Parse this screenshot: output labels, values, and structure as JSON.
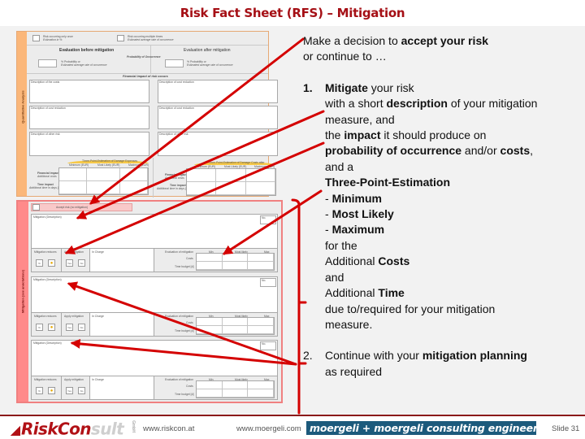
{
  "title": "Risk Fact Sheet (RFS) – Mitigation",
  "form": {
    "quant_section_label": "Quantitative Analysis",
    "mitigation_section_label": "Mitigation (see annotations)",
    "risk_once_label": "Risk occurring only once",
    "risk_once_sub": "Estimation in %",
    "risk_multi_label": "Risk occurring multiple times",
    "risk_multi_sub": "Estimated average rate of occurrence",
    "eval_before": "Evaluation before mitigation",
    "eval_after": "Evaluation after mitigation",
    "prob_occ": "Probability of Occurrence",
    "prob_label": "% Probability or",
    "prob_sub": "Estimated average rate of occurrence",
    "fin_impact_header": "Financial impact of risk occurs",
    "desc_costs": "Description of the costs",
    "desc_cost_reduction": "Description of cost reduction",
    "desc_other": "Description of other risk",
    "three_point_cost": "Three-Point-Estimation of Damage Expenses",
    "three_point_after": "Three-Point-Estimation of Damage Costs after",
    "col_min": "Minimum (EUR)",
    "col_ml": "Most Likely (EUR)",
    "col_max": "Maximum (EUR)",
    "fin_impact": "Financial impact",
    "fin_impact_sub": "Additional costs",
    "time_impact": "Time impact",
    "time_impact_sub": "Additional time in days [d]",
    "accept_label": "Accept risk (no mitigation)",
    "mit_desc_label": "Mitigation (Description)",
    "mit_no": "No.",
    "mit_reduces": "Mitigation reduces",
    "apply_mit": "Apply mitigation",
    "in_charge": "In Charge",
    "eval_mit": "Evaluation of mitigation",
    "costs": "Costs",
    "time_budget": "Time budget [d]",
    "min": "Min",
    "most_likely": "Most likely",
    "max": "Max",
    "pct": "%",
    "yes": "Yes",
    "no": "No",
    "coin_icon": "coins-icon"
  },
  "text": {
    "intro_1": "Make a decision to ",
    "intro_1_b": "accept your risk",
    "intro_2": "or continue to …",
    "item1_num": "1.",
    "item1_b": "Mitigate",
    "item1_rest": " your risk",
    "l2a": "with a short ",
    "l2b": "description",
    "l2c": " of your mitigation",
    "l3": "measure, and",
    "l4a": "the ",
    "l4b": "impact",
    "l4c": " it should produce on",
    "l5a": "probability of occurrence",
    "l5b": " and/or ",
    "l5c": "costs",
    "l5d": ",",
    "l6": "and a",
    "l7": "Three-Point-Estimation",
    "l8a": "- ",
    "l8b": "Minimum",
    "l9b": "Most Likely",
    "l10b": "Maximum",
    "l11": "for the",
    "l12a": "Additional ",
    "l12b": "Costs",
    "l13": "and",
    "l14a": "Additional ",
    "l14b": "Time",
    "l15": "due to/required for your mitigation",
    "l16": "measure.",
    "item2_num": "2.",
    "item2_a": "Continue with your ",
    "item2_b": "mitigation planning",
    "item2_c": "as required"
  },
  "footer": {
    "logo_a": "RiskCon",
    "logo_b": "sult",
    "logo_gmbh": "GmbH",
    "url1": "www.riskcon.at",
    "url2": "www.moergeli.com",
    "badge": "moergeli + moergeli consulting engineering",
    "slide": "Slide 31"
  },
  "colors": {
    "title": "#a50f15",
    "arrow": "#d40000",
    "quant_accent": "#fbb77a",
    "mit_accent": "#ff8a8a",
    "badge": "#1c5a7c"
  }
}
